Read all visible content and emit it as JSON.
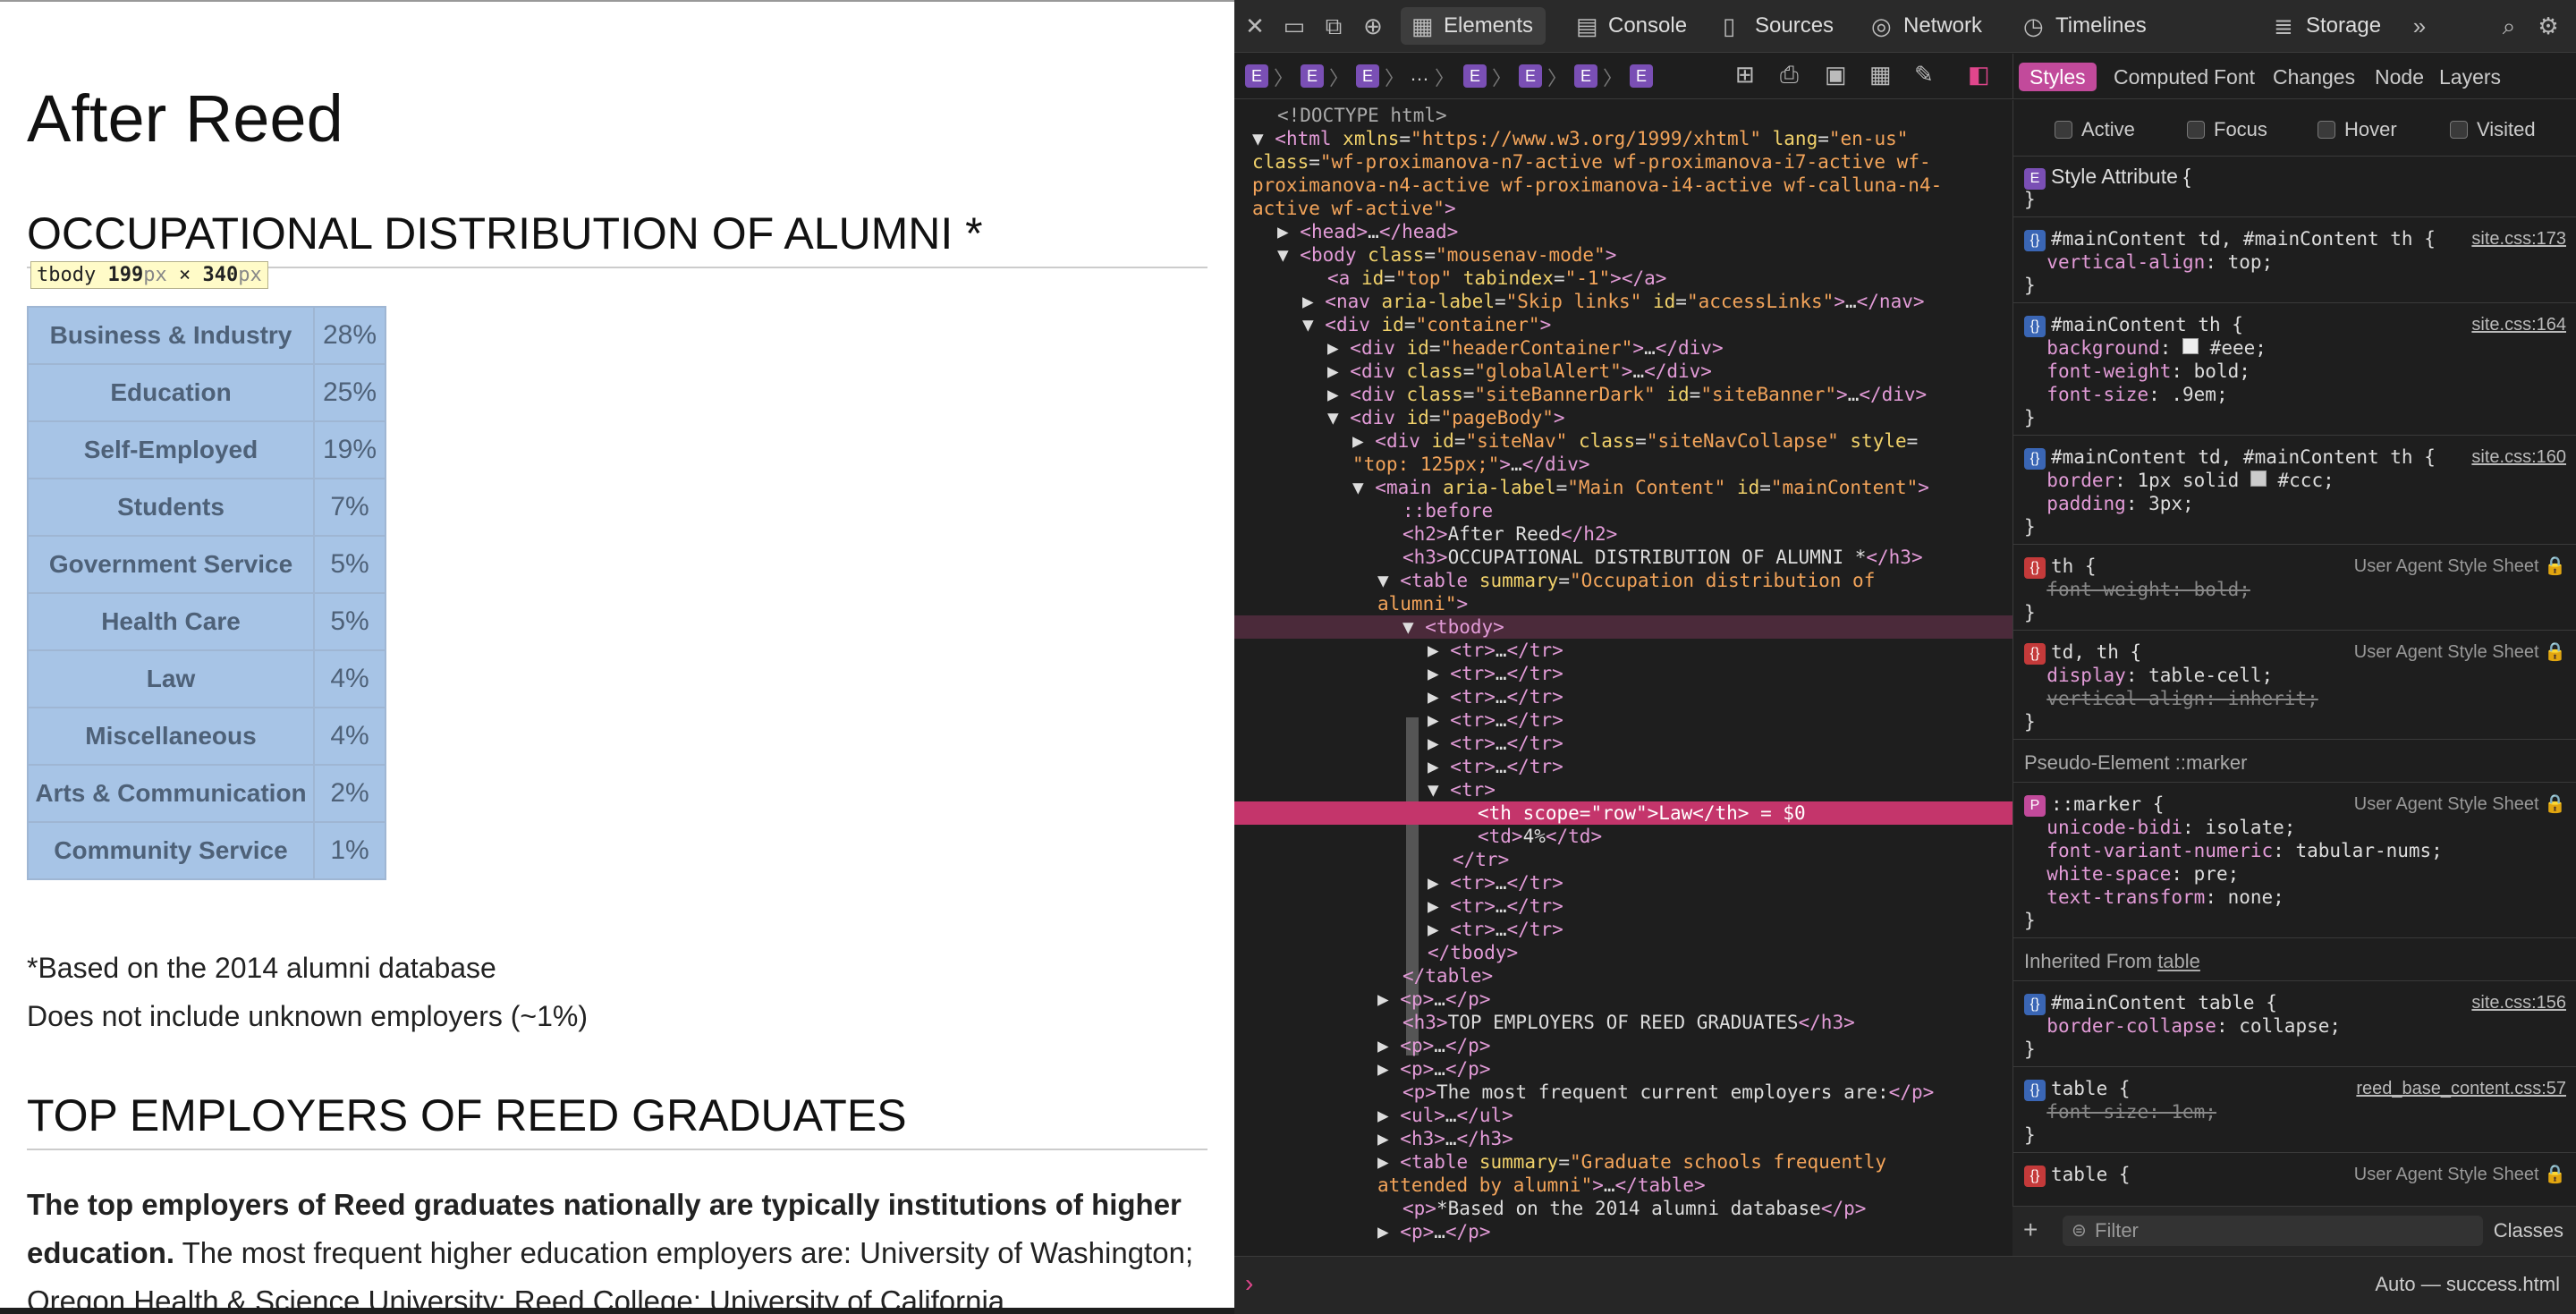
{
  "page": {
    "title": "After Reed",
    "section1": "OCCUPATIONAL DISTRIBUTION OF ALUMNI *",
    "tooltip": {
      "tag": "tbody",
      "w": "199",
      "h": "340",
      "unit": "px"
    },
    "rows": [
      {
        "label": "Business & Industry",
        "value": "28%"
      },
      {
        "label": "Education",
        "value": "25%"
      },
      {
        "label": "Self-Employed",
        "value": "19%"
      },
      {
        "label": "Students",
        "value": "7%"
      },
      {
        "label": "Government Service",
        "value": "5%"
      },
      {
        "label": "Health Care",
        "value": "5%"
      },
      {
        "label": "Law",
        "value": "4%"
      },
      {
        "label": "Miscellaneous",
        "value": "4%"
      },
      {
        "label": "Arts & Communication",
        "value": "2%"
      },
      {
        "label": "Community Service",
        "value": "1%"
      }
    ],
    "note1": "*Based on the 2014 alumni database",
    "note2": "Does not include unknown employers (~1%)",
    "section2": "TOP EMPLOYERS OF REED GRADUATES",
    "para_bold": "The top employers of Reed graduates nationally are typically institutions of higher education.",
    "para_rest": " The most frequent higher education employers are: University of Washington; Oregon Health & Science University; Reed College; University of California"
  },
  "devtools": {
    "tabs": [
      "Elements",
      "Console",
      "Sources",
      "Network",
      "Timelines",
      "Storage"
    ],
    "side_tabs": [
      "Styles",
      "Computed",
      "Font",
      "Changes",
      "Node",
      "Layers"
    ],
    "states": [
      "Active",
      "Focus",
      "Hover",
      "Visited"
    ],
    "filter_placeholder": "Filter",
    "classes_label": "Classes",
    "console_target": "Auto — success.html",
    "style_attr": "Style Attribute {",
    "pseudo_header": "Pseudo-Element ::marker",
    "inherited_prefix": "Inherited From",
    "inherited_link": "table"
  }
}
